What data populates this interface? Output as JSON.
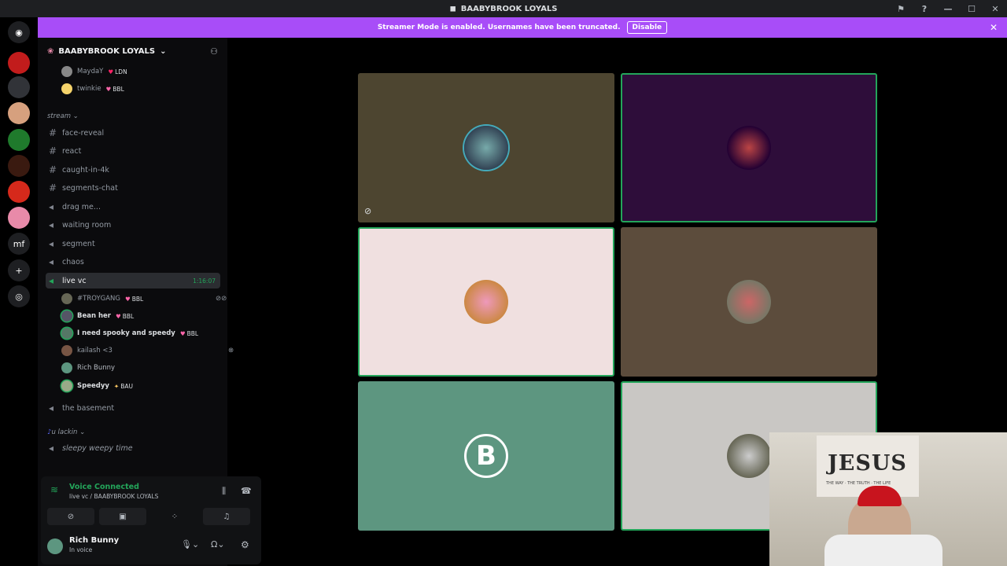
{
  "window": {
    "title": "BAABYBROOK LOYALS"
  },
  "banner": {
    "text": "Streamer Mode is enabled. Usernames have been truncated.",
    "disable_label": "Disable"
  },
  "guild": {
    "name": "BAABYBROOK LOYALS"
  },
  "top_members": [
    {
      "name": "MaydaY",
      "tag": "LDN"
    },
    {
      "name": "twinkie",
      "tag": "BBL"
    }
  ],
  "categories": {
    "stream": "stream",
    "u_lackin": "u lackin"
  },
  "channels": [
    {
      "name": "face-reveal",
      "type": "text"
    },
    {
      "name": "react",
      "type": "text"
    },
    {
      "name": "caught-in-4k",
      "type": "text"
    },
    {
      "name": "segments-chat",
      "type": "text"
    },
    {
      "name": "drag me...",
      "type": "voice"
    },
    {
      "name": "waiting room",
      "type": "voice"
    },
    {
      "name": "segment",
      "type": "voice"
    },
    {
      "name": "chaos",
      "type": "voice"
    },
    {
      "name": "live vc",
      "type": "voice",
      "timer": "1:16:07"
    }
  ],
  "vc_members": [
    {
      "name": "#TROYGANG",
      "tag": "BBL"
    },
    {
      "name": "Bean her",
      "tag": "BBL"
    },
    {
      "name": "I need spooky and speedy",
      "tag": "BBL"
    },
    {
      "name": "kailash <3",
      "tag": ""
    },
    {
      "name": "Rich Bunny",
      "tag": ""
    },
    {
      "name": "Speedyy",
      "tag": "BAU"
    }
  ],
  "more_channels": [
    {
      "name": "the basement"
    },
    {
      "name": "sleepy weepy time"
    }
  ],
  "voice_panel": {
    "status": "Voice Connected",
    "location": "live vc / BAABYBROOK LOYALS"
  },
  "user": {
    "name": "Rich Bunny",
    "status": "In voice"
  },
  "tiles": [
    {
      "bg": "#4d4530",
      "speaking": false
    },
    {
      "bg": "#2e0d3a",
      "speaking": true
    },
    {
      "bg": "#f0e0e0",
      "speaking": true
    },
    {
      "bg": "#5c4c3c",
      "speaking": false
    },
    {
      "bg": "#5d9680",
      "speaking": false,
      "letter": "B"
    },
    {
      "bg": "#c9c7c4",
      "speaking": true
    }
  ],
  "webcam": {
    "sign_text": "JESUS",
    "sign_sub": "THE WAY · THE TRUTH · THE LIFE"
  },
  "colors": {
    "accent": "#a84df8",
    "speaking": "#23a55a"
  }
}
